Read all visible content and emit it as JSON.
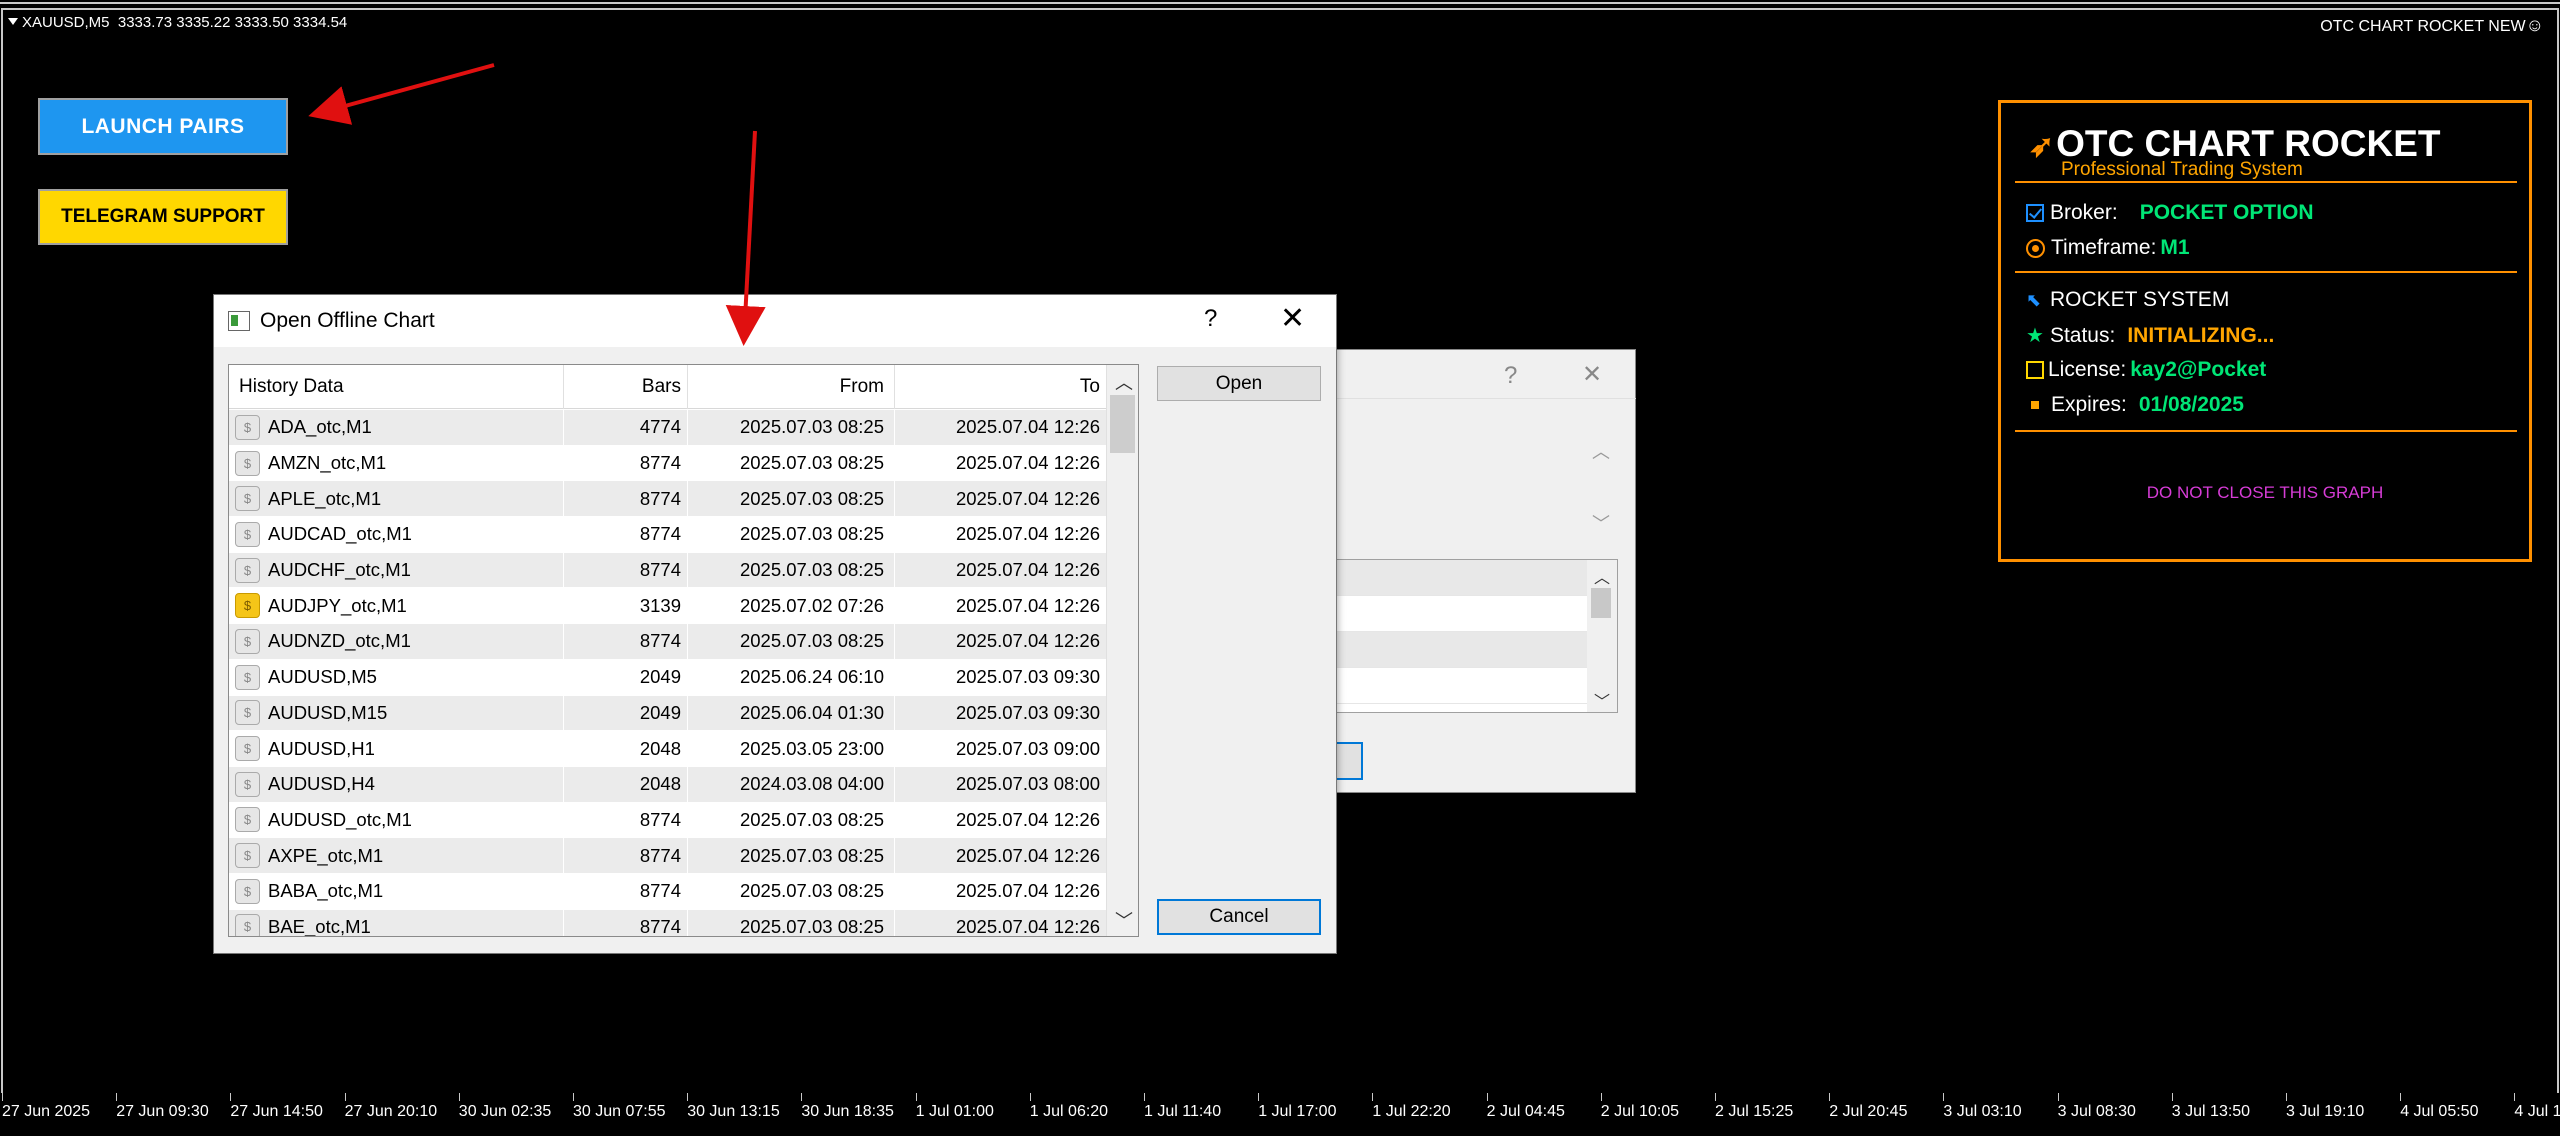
{
  "chart": {
    "symbol": "XAUUSD,M5",
    "prices": "3333.73 3335.22 3333.50 3334.54",
    "indicator": "OTC CHART ROCKET NEW",
    "indicator_icon": "smiley-icon"
  },
  "buttons": {
    "launch": "LAUNCH PAIRS",
    "telegram": "TELEGRAM SUPPORT"
  },
  "panel": {
    "title": "OTC CHART ROCKET",
    "subtitle": "Professional Trading System",
    "broker_label": "Broker:",
    "broker_value": "POCKET OPTION",
    "timeframe_label": "Timeframe:",
    "timeframe_value": "M1",
    "system_label": "ROCKET SYSTEM",
    "status_label": "Status:",
    "status_value": "INITIALIZING...",
    "license_label": "License:",
    "license_value": "kay2@Pocket",
    "expires_label": "Expires:",
    "expires_value": "01/08/2025",
    "warning": "DO NOT CLOSE THIS GRAPH",
    "colors": {
      "border": "#ff9000",
      "green": "#00e676",
      "orange": "#ffa500",
      "warning": "#d63cd6"
    }
  },
  "back_dialog": {
    "help": "?",
    "close": "✕"
  },
  "dialog": {
    "title": "Open Offline Chart",
    "help": "?",
    "close": "✕",
    "columns": [
      "History Data",
      "Bars",
      "From",
      "To"
    ],
    "rows": [
      {
        "name": "ADA_otc,M1",
        "bars": "4774",
        "from": "2025.07.03 08:25",
        "to": "2025.07.04 12:26",
        "icon": "generic"
      },
      {
        "name": "AMZN_otc,M1",
        "bars": "8774",
        "from": "2025.07.03 08:25",
        "to": "2025.07.04 12:26",
        "icon": "generic"
      },
      {
        "name": "APLE_otc,M1",
        "bars": "8774",
        "from": "2025.07.03 08:25",
        "to": "2025.07.04 12:26",
        "icon": "generic"
      },
      {
        "name": "AUDCAD_otc,M1",
        "bars": "8774",
        "from": "2025.07.03 08:25",
        "to": "2025.07.04 12:26",
        "icon": "generic"
      },
      {
        "name": "AUDCHF_otc,M1",
        "bars": "8774",
        "from": "2025.07.03 08:25",
        "to": "2025.07.04 12:26",
        "icon": "generic"
      },
      {
        "name": "AUDJPY_otc,M1",
        "bars": "3139",
        "from": "2025.07.02 07:26",
        "to": "2025.07.04 12:26",
        "icon": "highlight"
      },
      {
        "name": "AUDNZD_otc,M1",
        "bars": "8774",
        "from": "2025.07.03 08:25",
        "to": "2025.07.04 12:26",
        "icon": "generic"
      },
      {
        "name": "AUDUSD,M5",
        "bars": "2049",
        "from": "2025.06.24 06:10",
        "to": "2025.07.03 09:30",
        "icon": "generic"
      },
      {
        "name": "AUDUSD,M15",
        "bars": "2049",
        "from": "2025.06.04 01:30",
        "to": "2025.07.03 09:30",
        "icon": "generic"
      },
      {
        "name": "AUDUSD,H1",
        "bars": "2048",
        "from": "2025.03.05 23:00",
        "to": "2025.07.03 09:00",
        "icon": "generic"
      },
      {
        "name": "AUDUSD,H4",
        "bars": "2048",
        "from": "2024.03.08 04:00",
        "to": "2025.07.03 08:00",
        "icon": "generic"
      },
      {
        "name": "AUDUSD_otc,M1",
        "bars": "8774",
        "from": "2025.07.03 08:25",
        "to": "2025.07.04 12:26",
        "icon": "generic"
      },
      {
        "name": "AXPE_otc,M1",
        "bars": "8774",
        "from": "2025.07.03 08:25",
        "to": "2025.07.04 12:26",
        "icon": "generic"
      },
      {
        "name": "BABA_otc,M1",
        "bars": "8774",
        "from": "2025.07.03 08:25",
        "to": "2025.07.04 12:26",
        "icon": "generic"
      },
      {
        "name": "BAE_otc,M1",
        "bars": "8774",
        "from": "2025.07.03 08:25",
        "to": "2025.07.04 12:26",
        "icon": "generic"
      }
    ],
    "open_label": "Open",
    "cancel_label": "Cancel"
  },
  "time_axis": [
    "27 Jun 2025",
    "27 Jun 09:30",
    "27 Jun 14:50",
    "27 Jun 20:10",
    "30 Jun 02:35",
    "30 Jun 07:55",
    "30 Jun 13:15",
    "30 Jun 18:35",
    "1 Jul 01:00",
    "1 Jul 06:20",
    "1 Jul 11:40",
    "1 Jul 17:00",
    "1 Jul 22:20",
    "2 Jul 04:45",
    "2 Jul 10:05",
    "2 Jul 15:25",
    "2 Jul 20:45",
    "3 Jul 03:10",
    "3 Jul 08:30",
    "3 Jul 13:50",
    "3 Jul 19:10",
    "4 Jul 05:50",
    "4 Jul 1"
  ]
}
